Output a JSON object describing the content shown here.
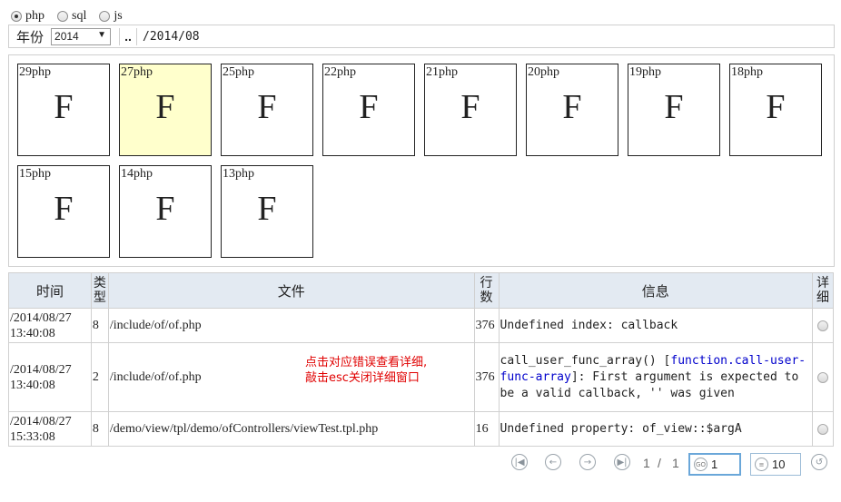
{
  "lang_options": [
    {
      "label": "php",
      "checked": true
    },
    {
      "label": "sql",
      "checked": false
    },
    {
      "label": "js",
      "checked": false
    }
  ],
  "year_bar": {
    "label": "年份",
    "selected_year": "2014",
    "up_label": "..",
    "path": "/2014/08"
  },
  "folders": [
    {
      "label": "29php",
      "letter": "F",
      "selected": false
    },
    {
      "label": "27php",
      "letter": "F",
      "selected": true
    },
    {
      "label": "25php",
      "letter": "F",
      "selected": false
    },
    {
      "label": "22php",
      "letter": "F",
      "selected": false
    },
    {
      "label": "21php",
      "letter": "F",
      "selected": false
    },
    {
      "label": "20php",
      "letter": "F",
      "selected": false
    },
    {
      "label": "19php",
      "letter": "F",
      "selected": false
    },
    {
      "label": "18php",
      "letter": "F",
      "selected": false
    },
    {
      "label": "15php",
      "letter": "F",
      "selected": false
    },
    {
      "label": "14php",
      "letter": "F",
      "selected": false
    },
    {
      "label": "13php",
      "letter": "F",
      "selected": false
    }
  ],
  "table": {
    "headers": {
      "time": "时间",
      "type": "类型",
      "file": "文件",
      "line": "行数",
      "message": "信息",
      "detail": "详细"
    },
    "rows": [
      {
        "time_date": "/2014/08/27",
        "time_clock": "13:40:08",
        "type": "8",
        "file": "/include/of/of.php",
        "line": "376",
        "message_plain": "Undefined index: callback"
      },
      {
        "time_date": "/2014/08/27",
        "time_clock": "13:40:08",
        "type": "2",
        "file": "/include/of/of.php",
        "line": "376",
        "message_pre": "call_user_func_array() [",
        "message_fn": "function.call-user-func-array",
        "message_post": "]: First argument is expected to be a valid callback, '' was given"
      },
      {
        "time_date": "/2014/08/27",
        "time_clock": "15:33:08",
        "type": "8",
        "file": "/demo/view/tpl/demo/ofControllers/viewTest.tpl.php",
        "line": "16",
        "message_plain": "Undefined property: of_view::$argA"
      }
    ]
  },
  "hint": {
    "line1": "点击对应错误查看详细,",
    "line2": "敲击esc关闭详细窗口",
    "color": "#e00000"
  },
  "pagination": {
    "current_page": "1",
    "separator": "/",
    "total_pages": "1",
    "page_input_value": "1",
    "page_size_value": "10",
    "go_icon_text": "GO"
  },
  "colors": {
    "header_bg": "#e3eaf2",
    "selected_tile_bg": "#ffffcc",
    "function_link": "#0000cc"
  }
}
